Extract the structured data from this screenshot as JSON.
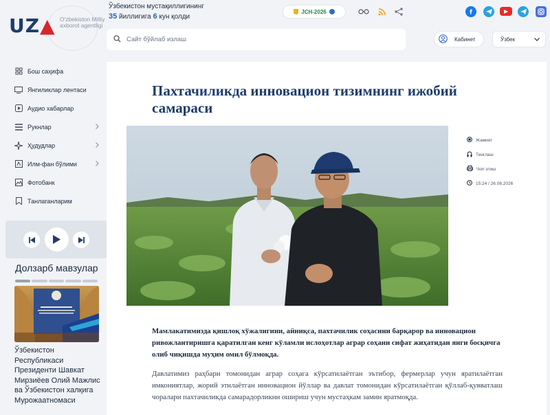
{
  "header": {
    "logo": {
      "brand": "UZA",
      "subtitle": "O'zbekiston Milliy axborot agentligi"
    },
    "independence": {
      "line1": "Ўзбекистон мустақиллигининг",
      "years": "35",
      "years_label": "йиллигига",
      "days": "6",
      "days_label": "кун қолди"
    },
    "jch_badge": "JCH-2026",
    "search": {
      "placeholder": "Сайт бўйлаб излаш"
    },
    "cabinet_label": "Кабинет",
    "language": "Ўзбек",
    "icons": [
      "glasses-icon",
      "rss-icon",
      "share-icon"
    ],
    "social": [
      {
        "name": "facebook",
        "color": "#1877f2"
      },
      {
        "name": "telegram",
        "color": "#2aa3e0"
      },
      {
        "name": "youtube",
        "color": "#e52d27"
      },
      {
        "name": "telegram-channel",
        "color": "#2aa3e0"
      },
      {
        "name": "instagram",
        "color": "#4a6ee0"
      }
    ]
  },
  "sidebar": {
    "items": [
      {
        "label": "Бош саҳифа",
        "icon": "home-icon",
        "has_children": false
      },
      {
        "label": "Янгиликлар лентаси",
        "icon": "news-feed-icon",
        "has_children": false
      },
      {
        "label": "Аудио хабарлар",
        "icon": "audio-icon",
        "has_children": false
      },
      {
        "label": "Рукнлар",
        "icon": "rubrics-icon",
        "has_children": true
      },
      {
        "label": "Ҳудудлар",
        "icon": "regions-icon",
        "has_children": true
      },
      {
        "label": "Илм-фан бўлими",
        "icon": "science-icon",
        "has_children": true
      },
      {
        "label": "Фотобанк",
        "icon": "photo-bank-icon",
        "has_children": false
      },
      {
        "label": "Танлаганларим",
        "icon": "bookmark-icon",
        "has_children": false
      }
    ],
    "topics_title": "Долзарб мавзулар",
    "topic_caption": "Ўзбекистон Республикаси Президенти Шавкат Мирзиёев Олий Мажлис ва Ўзбекистон халқига Мурожаатномаси"
  },
  "article": {
    "title": "Пахтачиликда инновацион тизимнинг ижобий самараси",
    "meta": {
      "category": "Жамият",
      "listen": "Тинглаш",
      "print": "Чоп этиш",
      "datetime": "15:24 / 26.08.2026"
    },
    "lead": "Мамлакатимизда қишлоқ хўжалигини, айниқса, пахтачилик соҳасини барқарор ва инновацион ривожлантиришга қаратилган кенг кўламли ислоҳотлар аграр соҳани сифат жиҳатидан янги босқичга олиб чиқишда муҳим омил бўлмоқда.",
    "body": "Давлатимиз раҳбари томонидан аграр соҳага кўрсатилаётган эътибор, фермерлар учун яратилаётган имкониятлар, жорий этилаётган инновацион йўллар ва давлат томонидан кўрсатилаётган қўллаб-қувватлаш чоралари пахтачиликда самарадорликни ошириш учун мустаҳкам замин яратмоқда."
  },
  "colors": {
    "brand": "#1f3d6b",
    "accent": "#d7262c",
    "link": "#2463c4"
  }
}
